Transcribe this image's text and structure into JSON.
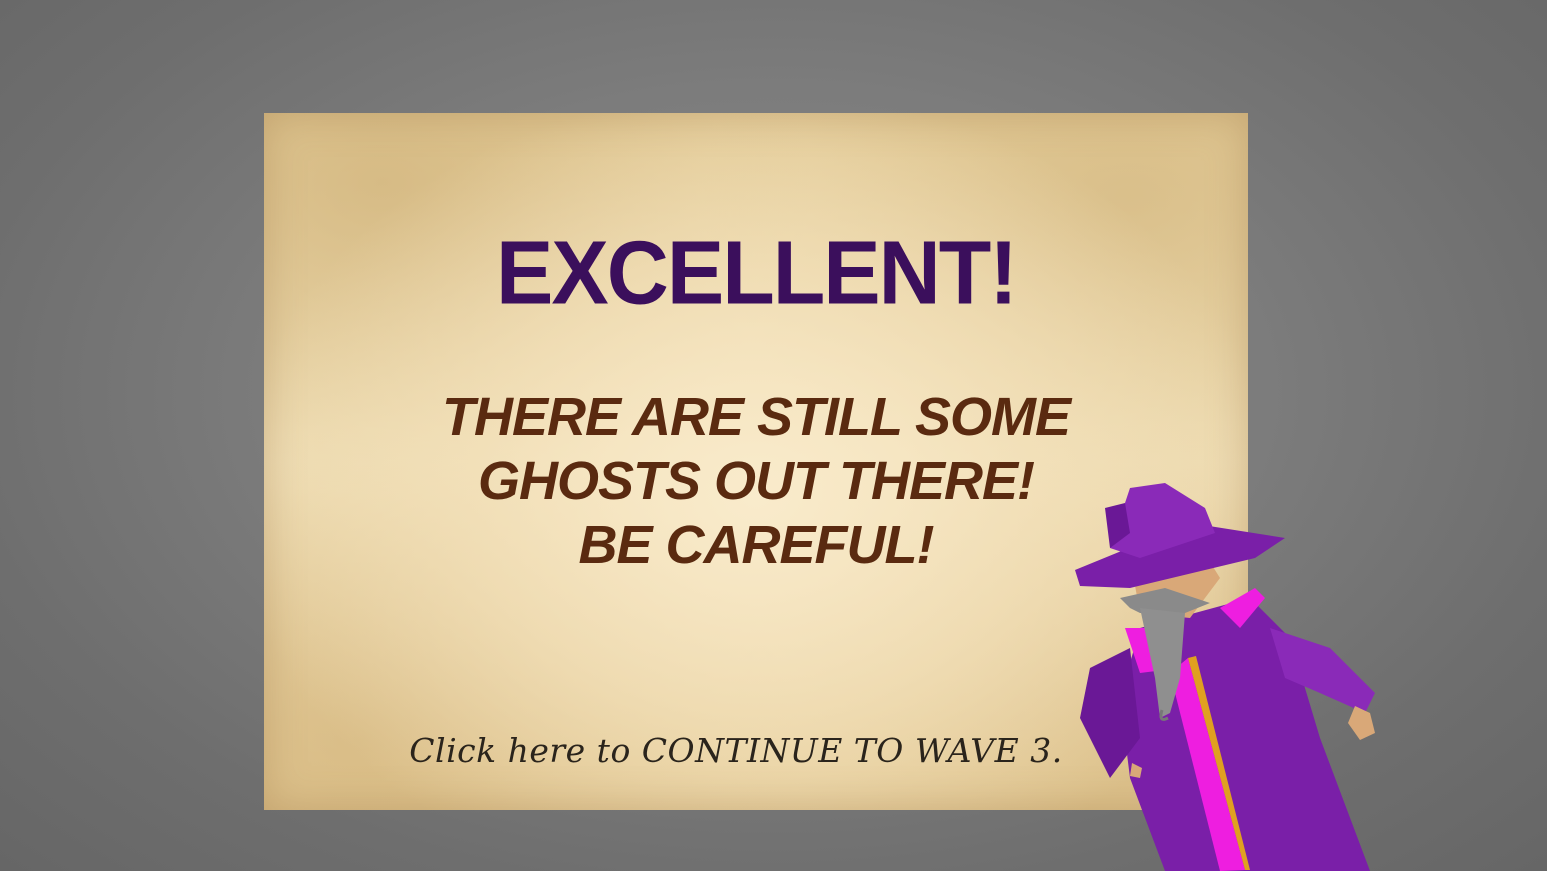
{
  "dialog": {
    "title": "EXCELLENT!",
    "message_lines": [
      "THERE ARE STILL SOME",
      "GHOSTS OUT THERE!",
      "BE CAREFUL!"
    ],
    "continue_text": "Click here to CONTINUE TO WAVE 3."
  },
  "colors": {
    "title": "#3b0f5c",
    "message": "#5a2a10",
    "wizard_robe": "#7a1fa8",
    "wizard_trim": "#ee1ee0"
  }
}
